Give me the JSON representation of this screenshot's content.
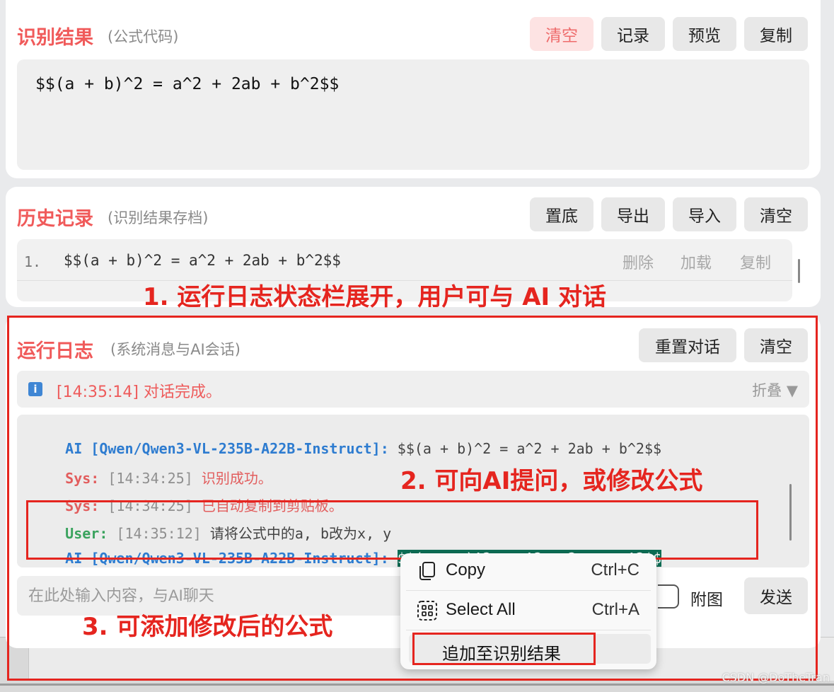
{
  "result": {
    "title": "识别结果",
    "subtitle": "(公式代码)",
    "buttons": {
      "clear": "清空",
      "history": "记录",
      "preview": "预览",
      "copy": "复制"
    },
    "code": "$$(a + b)^2 = a^2 + 2ab + b^2$$"
  },
  "history": {
    "title": "历史记录",
    "subtitle": "(识别结果存档)",
    "buttons": {
      "bottom": "置底",
      "export": "导出",
      "import": "导入",
      "clear": "清空"
    },
    "rows": [
      {
        "index": "1.",
        "code": "$$(a + b)^2 = a^2 + 2ab + b^2$$",
        "delete": "删除",
        "load": "加载",
        "copy": "复制"
      }
    ]
  },
  "log": {
    "title": "运行日志",
    "subtitle": "(系统消息与AI会话)",
    "buttons": {
      "reset": "重置对话",
      "clear": "清空"
    },
    "status": "[14:35:14] 对话完成。",
    "fold": "折叠 ▼",
    "messages": {
      "m1": {
        "who": "AI [Qwen/Qwen3-VL-235B-A22B-Instruct]:",
        "text": " $$(a + b)^2 = a^2 + 2ab + b^2$$"
      },
      "m2": {
        "who": "Sys:",
        "time": " [14:34:25] ",
        "text": "识别成功。"
      },
      "m3": {
        "who": "Sys:",
        "time": " [14:34:25] ",
        "text": "已自动复制到剪贴板。"
      },
      "m4": {
        "who": "User:",
        "time": " [14:35:12] ",
        "text": "请将公式中的a, b改为x, y"
      },
      "m5": {
        "who": "AI [Qwen/Qwen3-VL-235B-A22B-Instruct]:",
        "text": "$$(x + y)^2 = x^2 + 2xy + y^2$$"
      }
    },
    "input_placeholder": "在此处输入内容，与AI聊天",
    "attach_label": "附图",
    "send_label": "发送"
  },
  "context_menu": {
    "copy": "Copy",
    "copy_shortcut": "Ctrl+C",
    "select_all": "Select All",
    "select_all_shortcut": "Ctrl+A",
    "append": "追加至识别结果"
  },
  "annotations": {
    "a1": "1. 运行日志状态栏展开，用户可与 AI 对话",
    "a2": "2. 可向AI提问，或修改公式",
    "a3": "3. 可添加修改后的公式"
  },
  "watermark": "CSDN @DoTheTran",
  "colors": {
    "accent_red": "#f05a5a",
    "annotation_red": "#e5251f",
    "highlight": "#0d6e55",
    "ai_blue": "#2e7cd0",
    "user_green": "#3aa35e"
  }
}
